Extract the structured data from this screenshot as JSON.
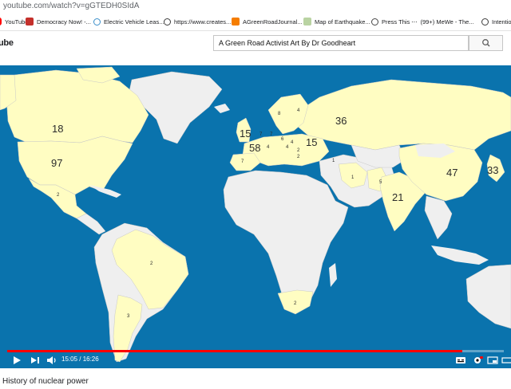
{
  "browser": {
    "url": "youtube.com/watch?v=gGTEDH0SIdA",
    "bookmarks": [
      {
        "label": "YouTube",
        "icon": "youtube-icon"
      },
      {
        "label": "Democracy Now! -...",
        "icon": "democracy-now-icon"
      },
      {
        "label": "Electric Vehicle Leas...",
        "icon": "ev-icon"
      },
      {
        "label": "https://www.creates...",
        "icon": "globe-icon"
      },
      {
        "label": "AGreenRoadJournal...",
        "icon": "blogger-icon"
      },
      {
        "label": "Map of Earthquake...",
        "icon": "map-icon"
      },
      {
        "label": "Press This",
        "icon": "wordpress-icon"
      },
      {
        "label": "(99+) MeWe - The...",
        "icon": "mewe-icon"
      },
      {
        "label": "Intentio",
        "icon": "globe-icon"
      }
    ]
  },
  "youtube": {
    "logo_text": "ube",
    "search_value": "A Green Road Activist Art By Dr Goodheart",
    "search_icon": "search-icon"
  },
  "map": {
    "ocean_color": "#0a73ad",
    "land_color": "#efefef",
    "highlight_color": "#fffdc2",
    "labels": [
      {
        "id": "canada",
        "text": "18"
      },
      {
        "id": "usa",
        "text": "97"
      },
      {
        "id": "mexico",
        "text": "2"
      },
      {
        "id": "brazil",
        "text": "2"
      },
      {
        "id": "argentina",
        "text": "3"
      },
      {
        "id": "russia",
        "text": "36"
      },
      {
        "id": "uk",
        "text": "15"
      },
      {
        "id": "france",
        "text": "58"
      },
      {
        "id": "germany",
        "text": "7"
      },
      {
        "id": "spain",
        "text": "7"
      },
      {
        "id": "ukraine",
        "text": "15"
      },
      {
        "id": "sweden",
        "text": "8"
      },
      {
        "id": "finland",
        "text": "4"
      },
      {
        "id": "belgium",
        "text": "7"
      },
      {
        "id": "czech",
        "text": "6"
      },
      {
        "id": "slovakia",
        "text": "4"
      },
      {
        "id": "switzerland",
        "text": "4"
      },
      {
        "id": "hungary",
        "text": "4"
      },
      {
        "id": "romania",
        "text": "2"
      },
      {
        "id": "bulgaria",
        "text": "2"
      },
      {
        "id": "armenia",
        "text": "1"
      },
      {
        "id": "iran",
        "text": "1"
      },
      {
        "id": "pakistan",
        "text": "5"
      },
      {
        "id": "india",
        "text": "21"
      },
      {
        "id": "china",
        "text": "47"
      },
      {
        "id": "japan",
        "text": "33"
      },
      {
        "id": "south-africa",
        "text": "2"
      }
    ]
  },
  "player": {
    "current_time": "15:05",
    "duration": "16:26",
    "timecode": "15:05 / 16:26",
    "progress": 0.9158
  },
  "video": {
    "title": "History of nuclear power"
  }
}
